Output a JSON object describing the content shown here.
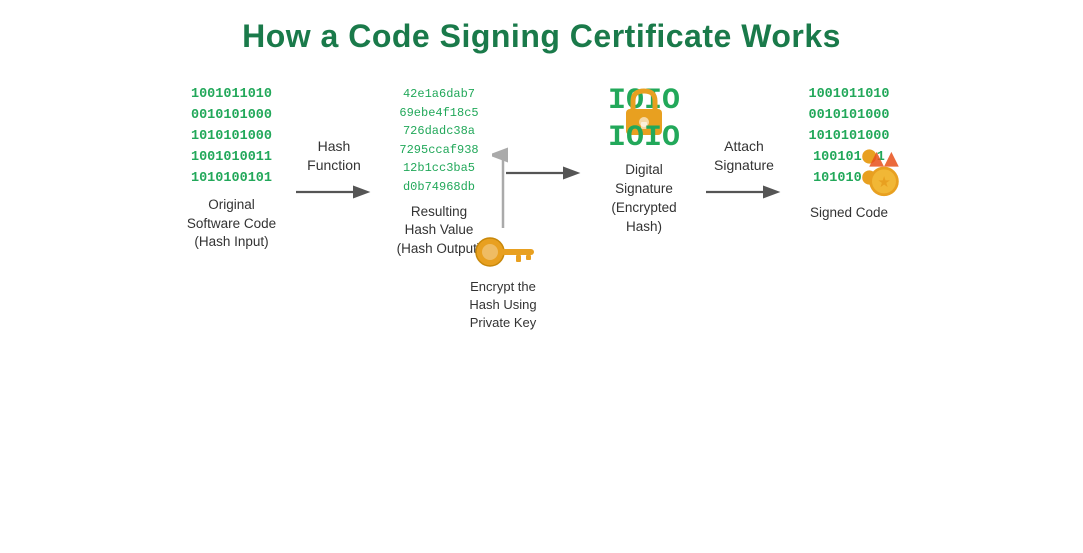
{
  "title": "How a Code Signing Certificate Works",
  "steps": {
    "binary": {
      "lines": [
        "1001011010",
        "0010101000",
        "1010101000",
        "1001010011",
        "1010100101"
      ]
    },
    "originalLabel": "Original\nSoftware Code\n(Hash Input)",
    "hashFunction": "Hash\nFunction",
    "hashValue": {
      "lines": [
        "42e1a6dab7",
        "69ebe4f18c5",
        "726dadc38a",
        "7295ccaf938",
        "12b1cc3ba5",
        "d0b74968db"
      ]
    },
    "hashValueLabel": "Resulting\nHash Value\n(Hash Output)",
    "digitalSigLabel": "Digital\nSignature\n(Encrypted\nHash)",
    "attachSignature": "Attach\nSignature",
    "signedCode": {
      "lines": [
        "1001011010",
        "0010101000",
        "1010101000",
        "1001010011",
        "1010100101"
      ]
    },
    "signedCodeLabel": "Signed Code",
    "privateKey": "Encrypt the\nHash Using\nPrivate Key"
  },
  "colors": {
    "green": "#22a85a",
    "title": "#1a7a4a",
    "text": "#333333",
    "arrow": "#888888",
    "gold": "#e8a020"
  }
}
